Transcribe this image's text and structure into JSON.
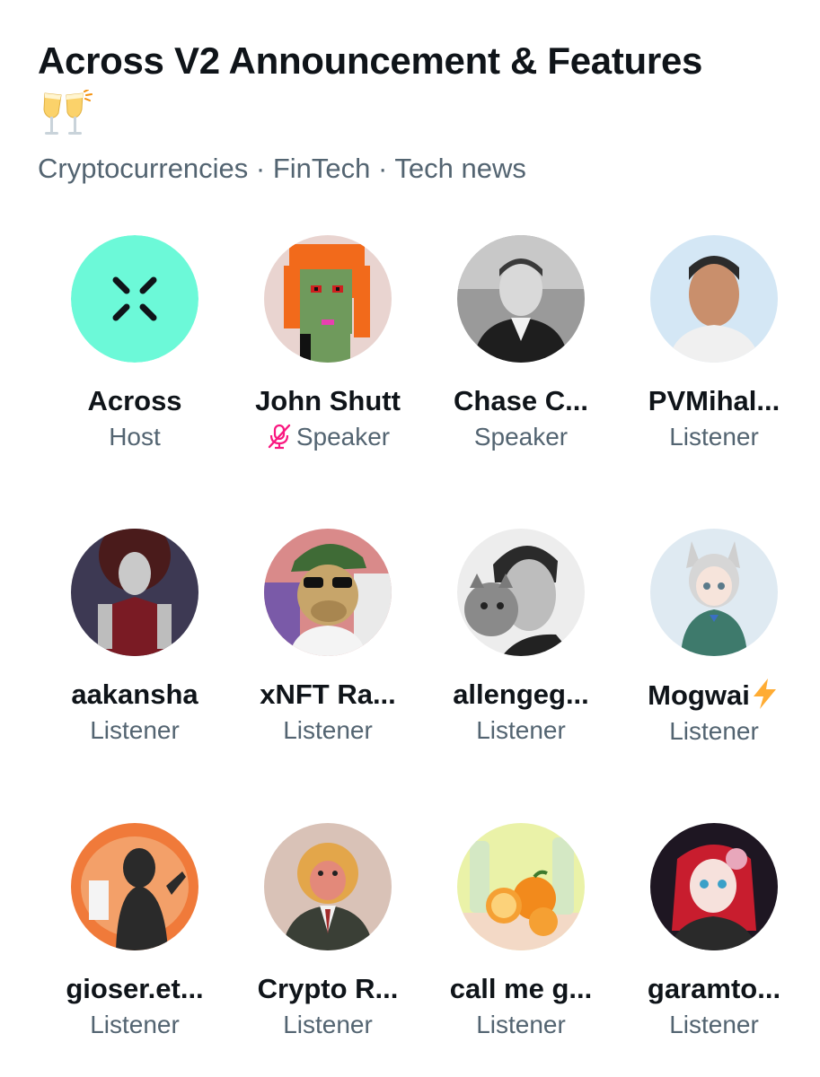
{
  "space": {
    "title": "Across V2 Announcement & Features",
    "title_emoji": "clinking-glasses-icon",
    "topics": "Cryptocurrencies · FinTech · Tech news"
  },
  "participants": [
    {
      "name": "Across",
      "role": "Host",
      "avatar": "across-logo-icon",
      "muted": false
    },
    {
      "name": "John Shutt",
      "role": "Speaker",
      "avatar": "pixel-punk-avatar",
      "muted": true
    },
    {
      "name": "Chase C...",
      "role": "Speaker",
      "avatar": "man-in-suit-photo",
      "muted": false
    },
    {
      "name": "PVMihal...",
      "role": "Listener",
      "avatar": "man-selfie-photo",
      "muted": false
    },
    {
      "name": "aakansha",
      "role": "Listener",
      "avatar": "robot-woman-art",
      "muted": false
    },
    {
      "name": "xNFT Ra...",
      "role": "Listener",
      "avatar": "ape-nft-art",
      "muted": false
    },
    {
      "name": "allengeg...",
      "role": "Listener",
      "avatar": "man-with-cat-photo",
      "muted": false
    },
    {
      "name": "Mogwai",
      "role": "Listener",
      "avatar": "anime-catgirl-art",
      "muted": false,
      "badge": "lightning-icon"
    },
    {
      "name": "gioser.et...",
      "role": "Listener",
      "avatar": "silhouette-art",
      "muted": false
    },
    {
      "name": "Crypto R...",
      "role": "Listener",
      "avatar": "monkey-in-suit-art",
      "muted": false
    },
    {
      "name": "call me g...",
      "role": "Listener",
      "avatar": "oranges-photo",
      "muted": false
    },
    {
      "name": "garamto...",
      "role": "Listener",
      "avatar": "anime-redhair-art",
      "muted": false
    }
  ],
  "colors": {
    "across_teal": "#6cf9d8",
    "muted_pink": "#f91880",
    "secondary_text": "#536471",
    "bolt_yellow": "#ffac33"
  }
}
